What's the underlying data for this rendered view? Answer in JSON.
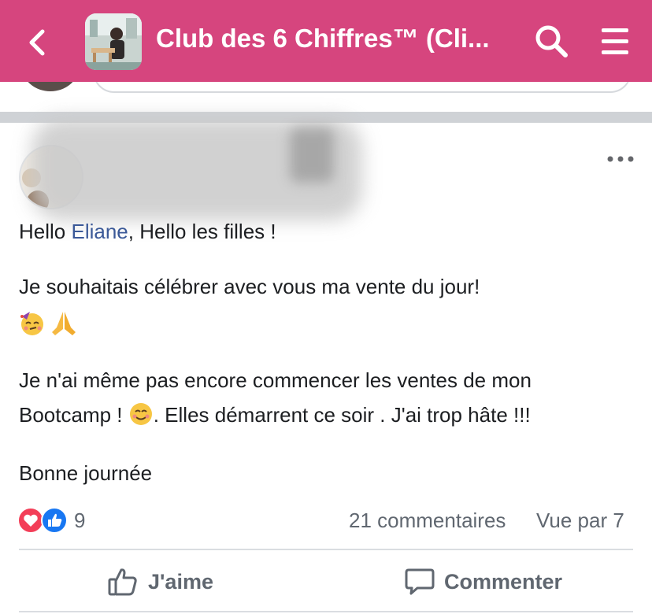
{
  "header": {
    "title": "Club des 6 Chiffres™ (Cli...",
    "background_color": "#d6457e",
    "icons": [
      "back-arrow-icon",
      "search-icon",
      "menu-icon"
    ]
  },
  "post": {
    "greeting_prefix": "Hello ",
    "mention": "Eliane",
    "greeting_suffix": ", Hello les filles !",
    "line2": "Je souhaitais célébrer avec vous ma vente du jour!",
    "emojis": [
      "partying-face-emoji",
      "folded-hands-emoji"
    ],
    "line3a": "Je n'ai même pas encore commencer les ventes de mon",
    "line3b_prefix": "Bootcamp ! ",
    "line3b_emoji": "smiling-face-emoji",
    "line3b_suffix": ". Elles démarrent  ce soir . J'ai trop hâte !!!",
    "line4": "Bonne journée"
  },
  "stats": {
    "reaction_icons": [
      "love-reaction-icon",
      "like-reaction-icon"
    ],
    "reaction_count": "9",
    "comments": "21 commentaires",
    "seen_by": "Vue par 7"
  },
  "actions": {
    "like_label": "J'aime",
    "comment_label": "Commenter"
  },
  "colors": {
    "mention": "#3b5998",
    "meta_text": "#606770"
  }
}
